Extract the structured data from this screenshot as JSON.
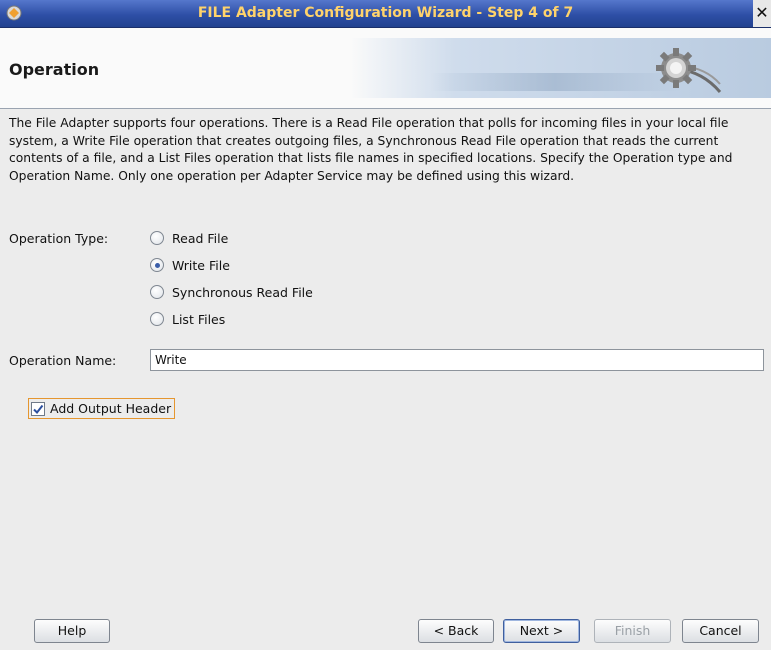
{
  "window": {
    "title": "FILE Adapter Configuration Wizard - Step 4 of 7",
    "close_glyph": "✕"
  },
  "header": {
    "title": "Operation"
  },
  "description": "The File Adapter supports four operations.  There is a Read File operation that polls for incoming files in your local file system, a Write File operation that creates outgoing files, a Synchronous Read File operation that reads the current contents of a file, and a List Files operation that lists file names in specified locations.  Specify the Operation type and Operation Name.  Only one operation per Adapter Service may be defined using this wizard.",
  "operation_type": {
    "label": "Operation Type:",
    "options": [
      {
        "label": "Read File",
        "selected": false
      },
      {
        "label": "Write File",
        "selected": true
      },
      {
        "label": "Synchronous Read File",
        "selected": false
      },
      {
        "label": "List Files",
        "selected": false
      }
    ]
  },
  "operation_name": {
    "label": "Operation Name:",
    "value": "Write"
  },
  "add_output_header": {
    "label": "Add Output Header",
    "checked": true
  },
  "buttons": {
    "help": "Help",
    "back": "< Back",
    "next": "Next >",
    "finish": "Finish",
    "cancel": "Cancel"
  },
  "colors": {
    "title_bar": "#2e4fa6",
    "title_text": "#ffd36b",
    "focus_border": "#e5962f",
    "selected_radio": "#3a5da8"
  }
}
